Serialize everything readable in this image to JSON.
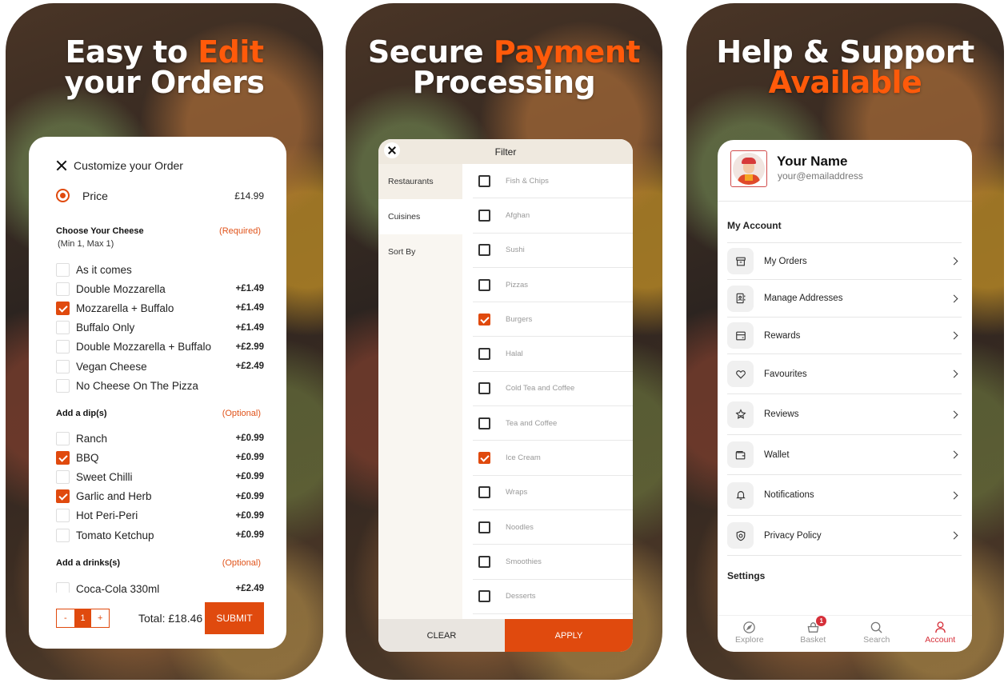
{
  "colors": {
    "accent": "#e04a0e",
    "headline_accent": "#ff5a0a",
    "account_active": "#d6303a"
  },
  "panels": [
    {
      "headline_part1": "Easy to ",
      "headline_accent": "Edit",
      "headline_line2": "your Orders"
    },
    {
      "headline_part1": "Secure ",
      "headline_accent": "Payment",
      "headline_line2": "Processing"
    },
    {
      "headline_line1": "Help & Support",
      "headline_accent": "Available"
    }
  ],
  "customize": {
    "title": "Customize your Order",
    "price_label": "Price",
    "price_value": "£14.99",
    "cheese": {
      "title": "Choose Your Cheese",
      "tag": "(Required)",
      "subtitle": "(Min 1, Max 1)",
      "options": [
        {
          "label": "As it comes",
          "price": "",
          "checked": false
        },
        {
          "label": "Double Mozzarella",
          "price": "+£1.49",
          "checked": false
        },
        {
          "label": "Mozzarella + Buffalo",
          "price": "+£1.49",
          "checked": true
        },
        {
          "label": "Buffalo Only",
          "price": "+£1.49",
          "checked": false
        },
        {
          "label": "Double Mozzarella + Buffalo",
          "price": "+£2.99",
          "checked": false
        },
        {
          "label": "Vegan Cheese",
          "price": "+£2.49",
          "checked": false
        },
        {
          "label": "No Cheese On The Pizza",
          "price": "",
          "checked": false
        }
      ]
    },
    "dips": {
      "title": "Add a dip(s)",
      "tag": "(Optional)",
      "options": [
        {
          "label": "Ranch",
          "price": "+£0.99",
          "checked": false
        },
        {
          "label": "BBQ",
          "price": "+£0.99",
          "checked": true
        },
        {
          "label": "Sweet Chilli",
          "price": "+£0.99",
          "checked": false
        },
        {
          "label": "Garlic and Herb",
          "price": "+£0.99",
          "checked": true
        },
        {
          "label": "Hot Peri-Peri",
          "price": "+£0.99",
          "checked": false
        },
        {
          "label": "Tomato Ketchup",
          "price": "+£0.99",
          "checked": false
        }
      ]
    },
    "drinks": {
      "title": "Add a drinks(s)",
      "tag": "(Optional)",
      "options": [
        {
          "label": "Coca-Cola 330ml",
          "price": "+£2.49",
          "checked": false
        }
      ]
    },
    "quantity": {
      "minus": "-",
      "value": "1",
      "plus": "+"
    },
    "total": "Total: £18.46",
    "submit_label": "SUBMIT"
  },
  "filter": {
    "title": "Filter",
    "tabs": [
      "Restaurants",
      "Cuisines",
      "Sort By"
    ],
    "items": [
      {
        "label": "Fish & Chips",
        "checked": false
      },
      {
        "label": "Afghan",
        "checked": false
      },
      {
        "label": "Sushi",
        "checked": false
      },
      {
        "label": "Pizzas",
        "checked": false
      },
      {
        "label": "Burgers",
        "checked": true
      },
      {
        "label": "Halal",
        "checked": false
      },
      {
        "label": "Cold Tea and Coffee",
        "checked": false
      },
      {
        "label": "Tea and Coffee",
        "checked": false
      },
      {
        "label": "Ice Cream",
        "checked": true
      },
      {
        "label": "Wraps",
        "checked": false
      },
      {
        "label": "Noodles",
        "checked": false
      },
      {
        "label": "Smoothies",
        "checked": false
      },
      {
        "label": "Desserts",
        "checked": false
      }
    ],
    "clear_label": "CLEAR",
    "apply_label": "APPLY"
  },
  "account": {
    "name": "Your Name",
    "email": "your@emailaddress",
    "section_my_account": "My Account",
    "items": [
      {
        "label": "My Orders",
        "icon": "archive-box-icon"
      },
      {
        "label": "Manage Addresses",
        "icon": "address-book-icon"
      },
      {
        "label": "Rewards",
        "icon": "card-icon"
      },
      {
        "label": "Favourites",
        "icon": "heart-icon"
      },
      {
        "label": "Reviews",
        "icon": "star-icon"
      },
      {
        "label": "Wallet",
        "icon": "wallet-icon"
      },
      {
        "label": "Notifications",
        "icon": "bell-icon"
      },
      {
        "label": "Privacy Policy",
        "icon": "shield-icon"
      }
    ],
    "section_settings": "Settings",
    "tabs": [
      {
        "label": "Explore",
        "icon": "compass-icon",
        "active": false
      },
      {
        "label": "Basket",
        "icon": "basket-icon",
        "active": false,
        "badge": "1"
      },
      {
        "label": "Search",
        "icon": "search-icon",
        "active": false
      },
      {
        "label": "Account",
        "icon": "user-icon",
        "active": true
      }
    ]
  }
}
